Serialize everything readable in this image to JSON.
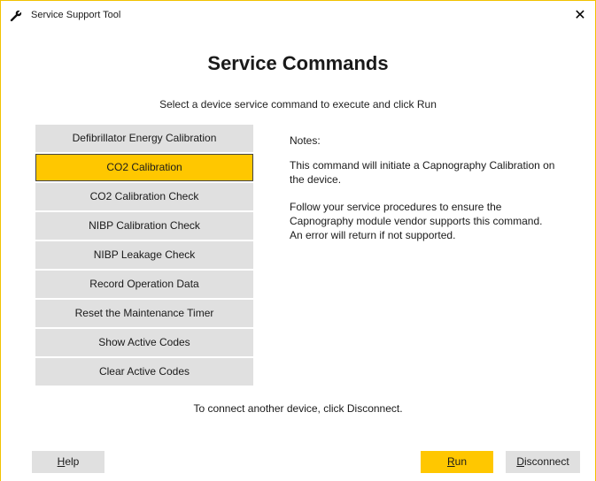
{
  "window": {
    "title": "Service Support Tool",
    "close_glyph": "✕"
  },
  "heading": "Service Commands",
  "subtitle": "Select a device service command to execute and click Run",
  "commands": [
    {
      "label": "Defibrillator Energy Calibration"
    },
    {
      "label": "CO2 Calibration",
      "selected": true
    },
    {
      "label": "CO2 Calibration Check"
    },
    {
      "label": "NIBP Calibration Check"
    },
    {
      "label": "NIBP Leakage Check"
    },
    {
      "label": "Record Operation Data"
    },
    {
      "label": "Reset the Maintenance Timer"
    },
    {
      "label": "Show Active Codes"
    },
    {
      "label": "Clear Active Codes"
    }
  ],
  "notes": {
    "label": "Notes:",
    "paragraphs": [
      "This command will initiate a Capnography Calibration on the device.",
      "Follow your service procedures to ensure the Capnography module vendor supports this command. An error will return if not supported."
    ]
  },
  "footer_text": "To connect another device, click Disconnect.",
  "buttons": {
    "help": {
      "underline": "H",
      "rest": "elp"
    },
    "run": {
      "underline": "R",
      "rest": "un"
    },
    "disconnect": {
      "underline": "D",
      "rest": "isconnect"
    }
  },
  "colors": {
    "accent": "#ffc700",
    "window_border": "#f2c200",
    "button_gray": "#e0e0e0"
  },
  "icons": {
    "title": "wrench-icon",
    "close": "close-icon"
  }
}
